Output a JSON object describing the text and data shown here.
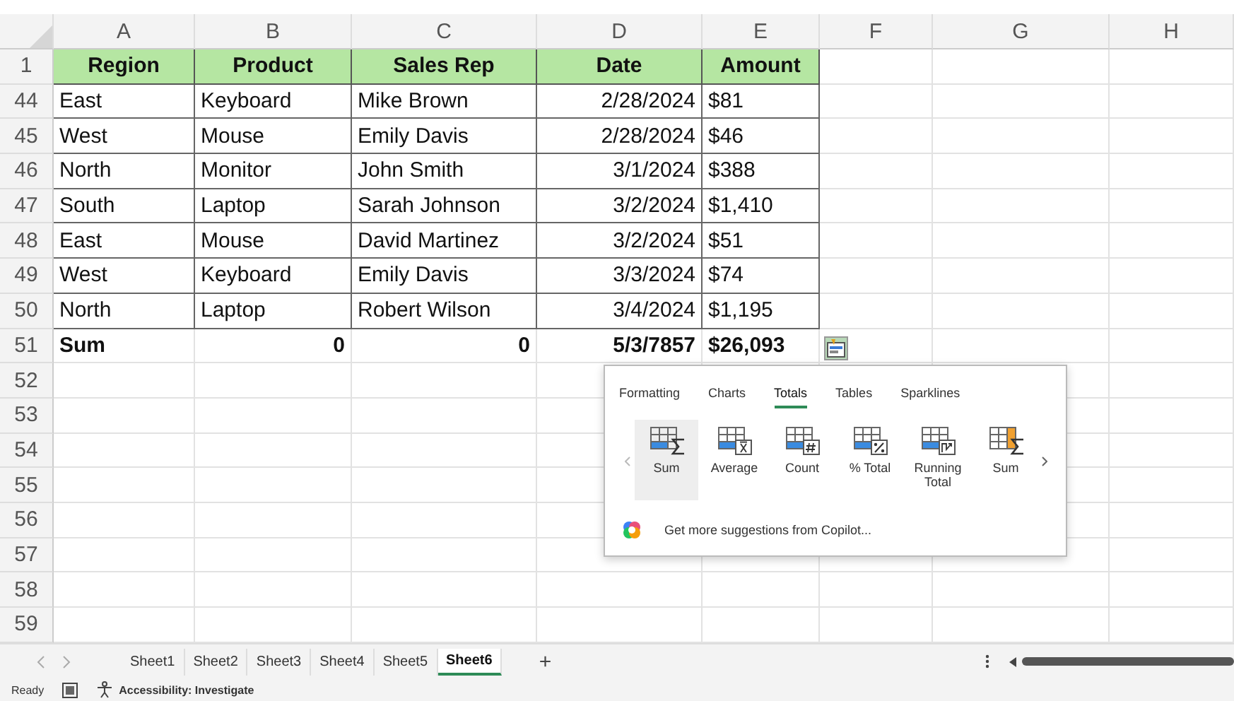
{
  "columns": [
    "A",
    "B",
    "C",
    "D",
    "E",
    "F",
    "G",
    "H"
  ],
  "rows": [
    {
      "number": "1",
      "kind": "header",
      "cells": [
        "Region",
        "Product",
        "Sales Rep",
        "Date",
        "Amount"
      ]
    },
    {
      "number": "44",
      "kind": "data",
      "cells": [
        "East",
        "Keyboard",
        "Mike Brown",
        "2/28/2024",
        "$81"
      ]
    },
    {
      "number": "45",
      "kind": "data",
      "cells": [
        "West",
        "Mouse",
        "Emily Davis",
        "2/28/2024",
        "$46"
      ]
    },
    {
      "number": "46",
      "kind": "data",
      "cells": [
        "North",
        "Monitor",
        "John Smith",
        "3/1/2024",
        "$388"
      ]
    },
    {
      "number": "47",
      "kind": "data",
      "cells": [
        "South",
        "Laptop",
        "Sarah Johnson",
        "3/2/2024",
        "$1,410"
      ]
    },
    {
      "number": "48",
      "kind": "data",
      "cells": [
        "East",
        "Mouse",
        "David Martinez",
        "3/2/2024",
        "$51"
      ]
    },
    {
      "number": "49",
      "kind": "data",
      "cells": [
        "West",
        "Keyboard",
        "Emily Davis",
        "3/3/2024",
        "$74"
      ]
    },
    {
      "number": "50",
      "kind": "data",
      "cells": [
        "North",
        "Laptop",
        "Robert Wilson",
        "3/4/2024",
        "$1,195"
      ]
    },
    {
      "number": "51",
      "kind": "total",
      "cells": [
        "Sum",
        "0",
        "0",
        "5/3/7857",
        "$26,093"
      ]
    },
    {
      "number": "52",
      "kind": "empty"
    },
    {
      "number": "53",
      "kind": "empty"
    },
    {
      "number": "54",
      "kind": "empty"
    },
    {
      "number": "55",
      "kind": "empty"
    },
    {
      "number": "56",
      "kind": "empty"
    },
    {
      "number": "57",
      "kind": "empty"
    },
    {
      "number": "58",
      "kind": "empty"
    },
    {
      "number": "59",
      "kind": "empty"
    }
  ],
  "quick_analysis": {
    "tabs": [
      {
        "label": "Formatting",
        "selected": false
      },
      {
        "label": "Charts",
        "selected": false
      },
      {
        "label": "Totals",
        "selected": true
      },
      {
        "label": "Tables",
        "selected": false
      },
      {
        "label": "Sparklines",
        "selected": false
      }
    ],
    "items": [
      {
        "kind": "sum",
        "label": "Sum",
        "selected": true
      },
      {
        "kind": "average",
        "label": "Average",
        "selected": false
      },
      {
        "kind": "count",
        "label": "Count",
        "selected": false
      },
      {
        "kind": "percent",
        "label": "% Total",
        "selected": false
      },
      {
        "kind": "running",
        "label": "Running Total",
        "selected": false
      },
      {
        "kind": "sum-column",
        "label": "Sum",
        "selected": false
      }
    ],
    "copilot_link": "Get more suggestions from Copilot..."
  },
  "sheet_tabs": [
    {
      "label": "Sheet1",
      "selected": false
    },
    {
      "label": "Sheet2",
      "selected": false
    },
    {
      "label": "Sheet3",
      "selected": false
    },
    {
      "label": "Sheet4",
      "selected": false
    },
    {
      "label": "Sheet5",
      "selected": false
    },
    {
      "label": "Sheet6",
      "selected": true
    }
  ],
  "add_sheet": "+",
  "status_bar": {
    "mode": "Ready",
    "accessibility": "Accessibility: Investigate"
  }
}
